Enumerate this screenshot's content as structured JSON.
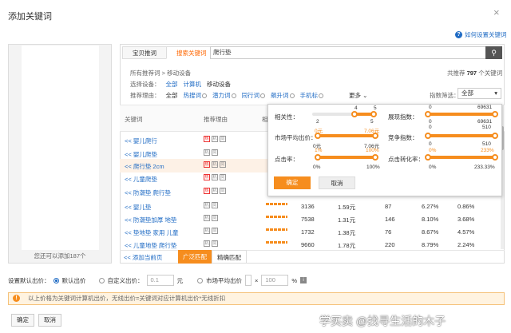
{
  "dialog": {
    "title": "添加关键词",
    "close": "×",
    "help": "如何设置关键词"
  },
  "left": {
    "footer": "您还可以添加187个"
  },
  "tabs": [
    "宝贝推词",
    "搜索关键词"
  ],
  "search": {
    "value": "爬行垫",
    "button_icon": "search-icon"
  },
  "breadcrumb": {
    "all": "所有推荐词",
    "sep": ">",
    "current": "移动设备"
  },
  "total": {
    "prefix": "共推荐",
    "count": "797",
    "suffix": "个关键词"
  },
  "device": {
    "label": "选择设备：",
    "options": [
      "全部",
      "计算机",
      "移动设备"
    ]
  },
  "reason": {
    "label": "推荐理由：",
    "options": [
      "全部",
      "热搜词",
      "潜力词",
      "同行词",
      "飙升词",
      "手机标"
    ]
  },
  "more": "更多",
  "filter": {
    "label": "指数筛选：",
    "value": "全部"
  },
  "table": {
    "headers": [
      "关键词",
      "推荐理由",
      "相"
    ],
    "rows": [
      {
        "kw": "<< 婴儿爬行",
        "icons": [
          "热",
          "机",
          "同"
        ],
        "hl": false
      },
      {
        "kw": "<< 婴儿爬垫",
        "icons": [
          "机",
          "同"
        ],
        "hl": false
      },
      {
        "kw": "<< 爬行垫 2cm",
        "icons": [
          "热",
          "机",
          "同"
        ],
        "hl": true
      },
      {
        "kw": "<< 儿童爬垫",
        "icons": [
          "热",
          "机",
          "同"
        ],
        "hl": false
      },
      {
        "kw": "<< 防潮垫 爬行垫",
        "icons": [
          "热",
          "机",
          "同"
        ],
        "hl": false
      },
      {
        "kw": "<< 婴儿垫",
        "icons": [
          "机",
          "同"
        ],
        "hl": false,
        "vals": [
          "3136",
          "1.59元",
          "87",
          "6.27%",
          "0.86%"
        ]
      },
      {
        "kw": "<< 防潮垫加厚 地垫",
        "icons": [
          "机",
          "同"
        ],
        "hl": false,
        "vals": [
          "7538",
          "1.31元",
          "146",
          "8.10%",
          "3.68%"
        ]
      },
      {
        "kw": "<< 垫地垫 家用 儿童",
        "icons": [
          "机",
          "同"
        ],
        "hl": false,
        "vals": [
          "1732",
          "1.38元",
          "76",
          "8.67%",
          "4.57%"
        ]
      },
      {
        "kw": "<< 儿童地垫 爬行垫",
        "icons": [
          "机",
          "同"
        ],
        "hl": false,
        "vals": [
          "9660",
          "1.78元",
          "220",
          "8.79%",
          "2.24%"
        ]
      }
    ]
  },
  "bottom_tabs": {
    "add_page": "<< 添加当前页",
    "broad": "广泛匹配",
    "exact": "精确匹配"
  },
  "popup": {
    "relevance": {
      "label": "相关性：",
      "min": "4",
      "max": "5"
    },
    "impressions": {
      "label": "展现指数：",
      "top_min": "0",
      "top_max": "69631",
      "bottom_min": "0",
      "bottom_max": "69631"
    },
    "avg_cpc": {
      "label": "市场平均出价：",
      "top_min": "2",
      "top_max": "5",
      "bottom_min": "0元",
      "bottom_max": "7.06元"
    },
    "competition": {
      "label": "竞争指数：",
      "top_min": "0",
      "top_max": "510",
      "bottom_min": "0",
      "bottom_max": "510"
    },
    "ctr": {
      "label": "点击率：",
      "top_min": "0元",
      "top_max": "7.06元",
      "bottom_min": "0%",
      "bottom_max": "100%",
      "mid_min": "1%",
      "mid_max": "100%"
    },
    "cvr": {
      "label": "点击转化率：",
      "top_min": "0",
      "top_max": "510",
      "mid_min": "0%",
      "mid_max": "233%",
      "bottom_min": "0%",
      "bottom_max": "233.33%"
    },
    "ok": "确定",
    "cancel": "取消"
  },
  "bid": {
    "label": "设置默认出价：",
    "default": "默认出价",
    "custom": "自定义出价：",
    "custom_value": "0.1",
    "unit": "元",
    "market": "市场平均出价",
    "times": "×",
    "pct_value": "100",
    "pct": "%"
  },
  "notice": "以上价格为关键词计算机出价，无线出价=关键词对应计算机出价*无线折扣",
  "footer": {
    "ok": "确定",
    "cancel": "取消"
  },
  "watermark": "学买卖 @找寻生活的木子",
  "colors": {
    "accent": "#f68d1e",
    "link": "#1f6bc4"
  }
}
